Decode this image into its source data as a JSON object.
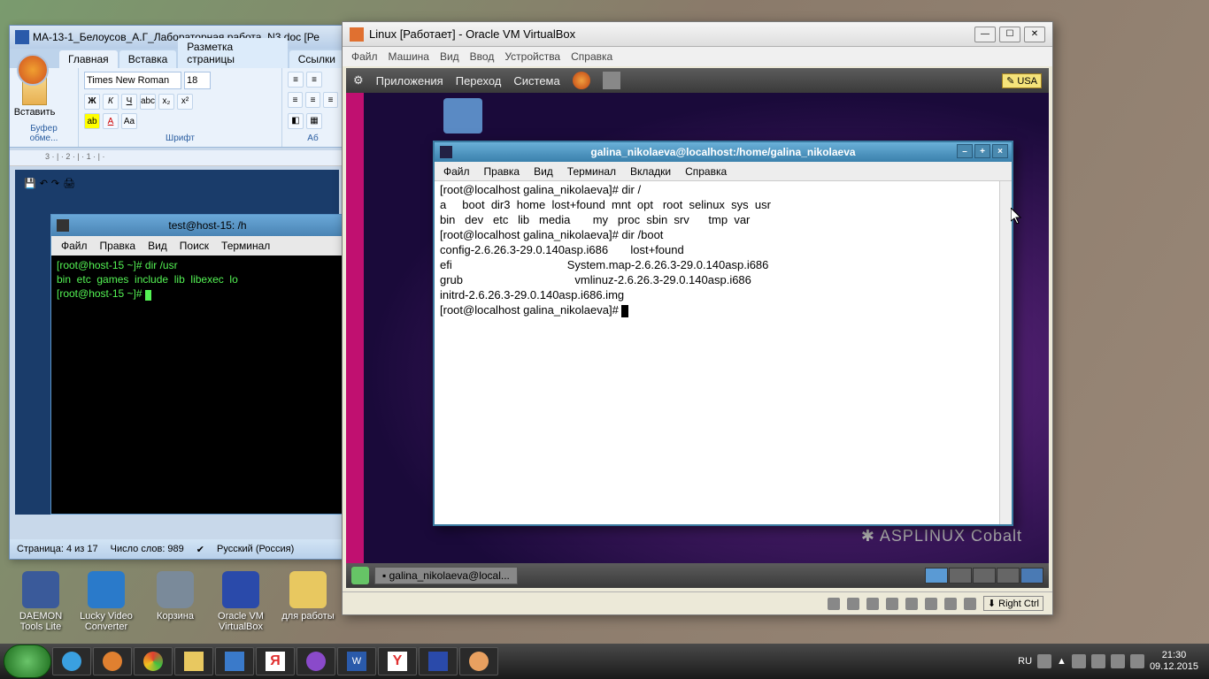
{
  "word": {
    "title": "МА-13-1_Белоусов_А.Г_Лабораторная работа_N3.doc [Ре",
    "tabs": [
      "Главная",
      "Вставка",
      "Разметка страницы",
      "Ссылки"
    ],
    "paste": "Вставить",
    "clipboard_label": "Буфер обме...",
    "font_name": "Times New Roman",
    "font_size": "18",
    "font_label": "Шрифт",
    "para_label": "Аб",
    "ruler": "3 · | · 2 · | · 1 · | ·",
    "status_page": "Страница: 4 из 17",
    "status_words": "Число слов: 989",
    "status_lang": "Русский (Россия)"
  },
  "term1": {
    "title": "test@host-15: /h",
    "menu": [
      "Файл",
      "Правка",
      "Вид",
      "Поиск",
      "Терминал"
    ],
    "body": "[root@host-15 ~]# dir /usr\nbin  etc  games  include  lib  libexec  lo\n[root@host-15 ~]# "
  },
  "vbox": {
    "title": "Linux [Работает] - Oracle VM VirtualBox",
    "menu": [
      "Файл",
      "Машина",
      "Вид",
      "Ввод",
      "Устройства",
      "Справка"
    ],
    "gnome_top": [
      "Приложения",
      "Переход",
      "Система"
    ],
    "usa": "USA",
    "task": "galina_nikolaeva@local...",
    "asp": "ASPLINUX Cobalt",
    "status_right": "Right Ctrl"
  },
  "term2": {
    "title": "galina_nikolaeva@localhost:/home/galina_nikolaeva",
    "menu": [
      "Файл",
      "Правка",
      "Вид",
      "Терминал",
      "Вкладки",
      "Справка"
    ],
    "body": "[root@localhost galina_nikolaeva]# dir /\na     boot  dir3  home  lost+found  mnt  opt   root  selinux  sys  usr\nbin   dev   etc   lib   media       my   proc  sbin  srv      tmp  var\n[root@localhost galina_nikolaeva]# dir /boot\nconfig-2.6.26.3-29.0.140asp.i686       lost+found\nefi                                    System.map-2.6.26.3-29.0.140asp.i686\ngrub                                   vmlinuz-2.6.26.3-29.0.140asp.i686\ninitrd-2.6.26.3-29.0.140asp.i686.img\n[root@localhost galina_nikolaeva]# "
  },
  "desktop_icons": [
    {
      "label": "DAEMON Tools Lite"
    },
    {
      "label": "Lucky Video Converter"
    },
    {
      "label": "Корзина"
    },
    {
      "label": "Oracle VM VirtualBox"
    },
    {
      "label": "для работы"
    }
  ],
  "tray": {
    "lang": "RU",
    "time": "21:30",
    "date": "09.12.2015"
  }
}
